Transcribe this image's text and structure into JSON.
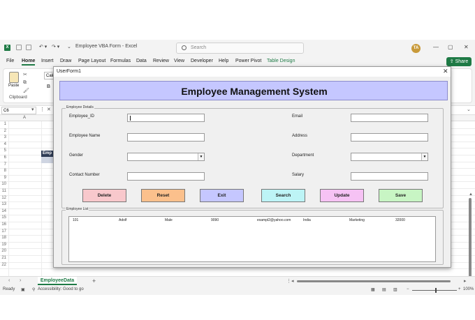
{
  "titlebar": {
    "doc_title": "Employee VBA Form  -  Excel",
    "search_placeholder": "Search",
    "user_initials": "TA"
  },
  "ribbon": {
    "tabs": [
      "File",
      "Home",
      "Insert",
      "Draw",
      "Page Layout",
      "Formulas",
      "Data",
      "Review",
      "View",
      "Developer",
      "Help",
      "Power Pivot",
      "Table Design"
    ],
    "active_tab": "Home",
    "share_label": "Share",
    "paste_label": "Paste",
    "clipboard_group_label": "Clipboard",
    "font_box_text": "Cali"
  },
  "formula_bar": {
    "name_box": "C6"
  },
  "grid": {
    "column_a": "A",
    "row_numbers": [
      "1",
      "2",
      "3",
      "4",
      "5",
      "6",
      "7",
      "8",
      "9",
      "10",
      "11",
      "12",
      "13",
      "14",
      "15",
      "16",
      "17",
      "18",
      "19",
      "20",
      "21",
      "22"
    ],
    "visible_cell_text": "Emp"
  },
  "sheets": {
    "active_sheet": "EmployeeData",
    "add_symbol": "+"
  },
  "statusbar": {
    "ready": "Ready",
    "accessibility": "Accessibility: Good to go",
    "zoom": "100%"
  },
  "userform": {
    "window_title": "UserForm1",
    "header": "Employee Management System",
    "details_frame_label": "Employee Details",
    "labels": {
      "employee_id": "Employee_ID",
      "employee_name": "Employee Name",
      "gender": "Gender",
      "contact_number": "Contact Number",
      "email": "Email",
      "address": "Address",
      "department": "Department",
      "salary": "Salary"
    },
    "buttons": {
      "delete": "Delete",
      "reset": "Reset",
      "exit": "Exit",
      "search": "Search",
      "update": "Update",
      "save": "Save"
    },
    "button_colors": {
      "delete": "#f8c8cc",
      "reset": "#fbc08c",
      "exit": "#c5c7ff",
      "search": "#bdf4f6",
      "update": "#f6c2f4",
      "save": "#c8f5c4"
    },
    "list_frame_label": "Employee List",
    "list_rows": [
      [
        "101",
        "Adolf",
        "Male",
        "9090",
        "exampl2@yahoo.com",
        "India",
        "Marketing",
        "32000"
      ]
    ]
  },
  "colors": {
    "excel_green": "#1e7a45",
    "header_band": "#c5c7ff"
  }
}
